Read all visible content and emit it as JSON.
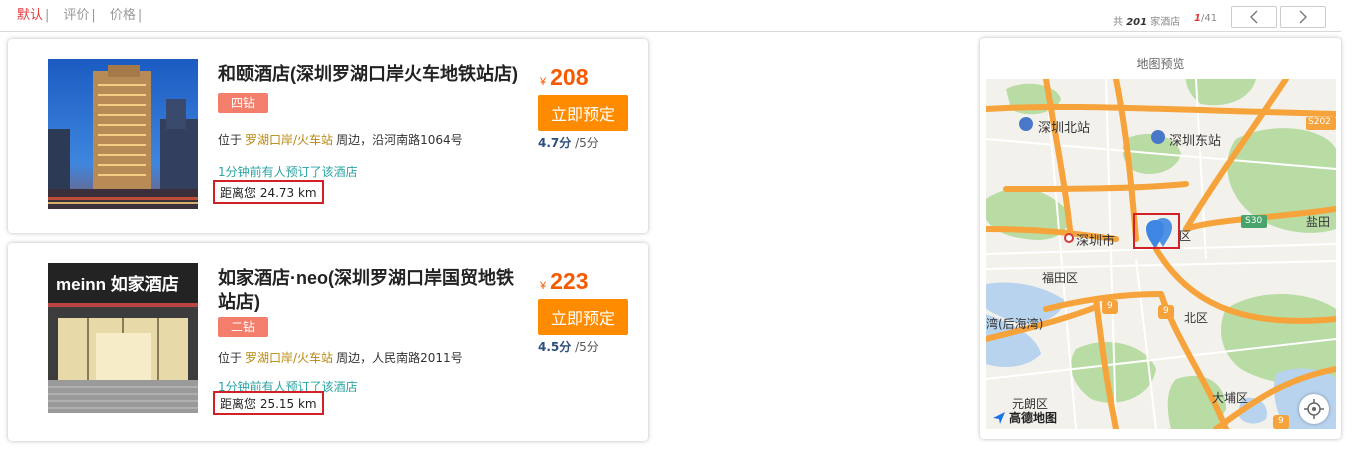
{
  "sort": {
    "tabs": [
      "默认",
      "评价",
      "价格"
    ],
    "separator": "|"
  },
  "results": {
    "prefix": "共",
    "count": "201",
    "suffix": "家酒店",
    "page_current": "1",
    "page_total": "/41"
  },
  "hotels": [
    {
      "name": "和颐酒店(深圳罗湖口岸火车地铁站店)",
      "level": "四钻",
      "addr_prefix": "位于",
      "area": "罗湖口岸/火车站",
      "addr_rest": "周边，沿河南路1064号",
      "recent": "1分钟前有人预订了该酒店",
      "distance": "距离您  24.73 km",
      "currency": "¥",
      "price": "208",
      "book_label": "立即预定",
      "score": "4.7分",
      "score_total": "/5分"
    },
    {
      "name": "如家酒店·neo(深圳罗湖口岸国贸地铁站店)",
      "level": "二钻",
      "addr_prefix": "位于",
      "area": "罗湖口岸/火车站",
      "addr_rest": "周边，人民南路2011号",
      "recent": "1分钟前有人预订了该酒店",
      "distance": "距离您  25.15 km",
      "currency": "¥",
      "price": "223",
      "book_label": "立即预定",
      "score": "4.5分",
      "score_total": "/5分",
      "sign_text": "meinn 如家酒店"
    }
  ],
  "map": {
    "title": "地图预览",
    "labels": {
      "north_station": "深圳北站",
      "east_station": "深圳东站",
      "city": "深圳市",
      "futian": "福田区",
      "district_suffix": "区",
      "bay": "湾(后海湾)",
      "north_district": "北区",
      "yuanlang": "元朗区",
      "tai_po": "大埔区",
      "yantian": "盐田",
      "s202": "S202",
      "s30": "S30",
      "nine_a": "9",
      "nine_b": "9",
      "nine_c": "9",
      "logo": "高德地图"
    },
    "colors": {
      "highway": "#f6a33b",
      "road": "#ffffff",
      "green": "#b9dca4",
      "water": "#b7d3ee",
      "marker": "#3d86e4"
    }
  }
}
